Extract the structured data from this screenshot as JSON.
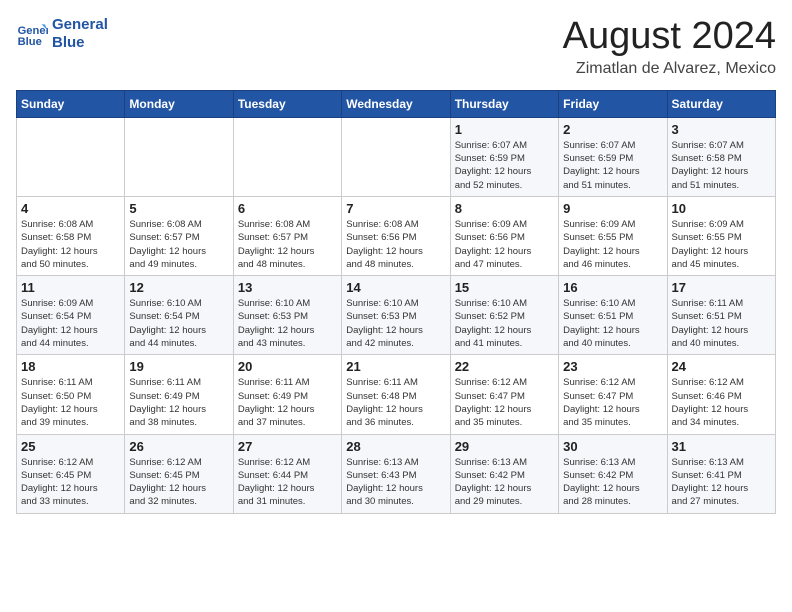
{
  "header": {
    "logo_line1": "General",
    "logo_line2": "Blue",
    "month_year": "August 2024",
    "location": "Zimatlan de Alvarez, Mexico"
  },
  "days_of_week": [
    "Sunday",
    "Monday",
    "Tuesday",
    "Wednesday",
    "Thursday",
    "Friday",
    "Saturday"
  ],
  "weeks": [
    [
      {
        "day": "",
        "info": ""
      },
      {
        "day": "",
        "info": ""
      },
      {
        "day": "",
        "info": ""
      },
      {
        "day": "",
        "info": ""
      },
      {
        "day": "1",
        "info": "Sunrise: 6:07 AM\nSunset: 6:59 PM\nDaylight: 12 hours\nand 52 minutes."
      },
      {
        "day": "2",
        "info": "Sunrise: 6:07 AM\nSunset: 6:59 PM\nDaylight: 12 hours\nand 51 minutes."
      },
      {
        "day": "3",
        "info": "Sunrise: 6:07 AM\nSunset: 6:58 PM\nDaylight: 12 hours\nand 51 minutes."
      }
    ],
    [
      {
        "day": "4",
        "info": "Sunrise: 6:08 AM\nSunset: 6:58 PM\nDaylight: 12 hours\nand 50 minutes."
      },
      {
        "day": "5",
        "info": "Sunrise: 6:08 AM\nSunset: 6:57 PM\nDaylight: 12 hours\nand 49 minutes."
      },
      {
        "day": "6",
        "info": "Sunrise: 6:08 AM\nSunset: 6:57 PM\nDaylight: 12 hours\nand 48 minutes."
      },
      {
        "day": "7",
        "info": "Sunrise: 6:08 AM\nSunset: 6:56 PM\nDaylight: 12 hours\nand 48 minutes."
      },
      {
        "day": "8",
        "info": "Sunrise: 6:09 AM\nSunset: 6:56 PM\nDaylight: 12 hours\nand 47 minutes."
      },
      {
        "day": "9",
        "info": "Sunrise: 6:09 AM\nSunset: 6:55 PM\nDaylight: 12 hours\nand 46 minutes."
      },
      {
        "day": "10",
        "info": "Sunrise: 6:09 AM\nSunset: 6:55 PM\nDaylight: 12 hours\nand 45 minutes."
      }
    ],
    [
      {
        "day": "11",
        "info": "Sunrise: 6:09 AM\nSunset: 6:54 PM\nDaylight: 12 hours\nand 44 minutes."
      },
      {
        "day": "12",
        "info": "Sunrise: 6:10 AM\nSunset: 6:54 PM\nDaylight: 12 hours\nand 44 minutes."
      },
      {
        "day": "13",
        "info": "Sunrise: 6:10 AM\nSunset: 6:53 PM\nDaylight: 12 hours\nand 43 minutes."
      },
      {
        "day": "14",
        "info": "Sunrise: 6:10 AM\nSunset: 6:53 PM\nDaylight: 12 hours\nand 42 minutes."
      },
      {
        "day": "15",
        "info": "Sunrise: 6:10 AM\nSunset: 6:52 PM\nDaylight: 12 hours\nand 41 minutes."
      },
      {
        "day": "16",
        "info": "Sunrise: 6:10 AM\nSunset: 6:51 PM\nDaylight: 12 hours\nand 40 minutes."
      },
      {
        "day": "17",
        "info": "Sunrise: 6:11 AM\nSunset: 6:51 PM\nDaylight: 12 hours\nand 40 minutes."
      }
    ],
    [
      {
        "day": "18",
        "info": "Sunrise: 6:11 AM\nSunset: 6:50 PM\nDaylight: 12 hours\nand 39 minutes."
      },
      {
        "day": "19",
        "info": "Sunrise: 6:11 AM\nSunset: 6:49 PM\nDaylight: 12 hours\nand 38 minutes."
      },
      {
        "day": "20",
        "info": "Sunrise: 6:11 AM\nSunset: 6:49 PM\nDaylight: 12 hours\nand 37 minutes."
      },
      {
        "day": "21",
        "info": "Sunrise: 6:11 AM\nSunset: 6:48 PM\nDaylight: 12 hours\nand 36 minutes."
      },
      {
        "day": "22",
        "info": "Sunrise: 6:12 AM\nSunset: 6:47 PM\nDaylight: 12 hours\nand 35 minutes."
      },
      {
        "day": "23",
        "info": "Sunrise: 6:12 AM\nSunset: 6:47 PM\nDaylight: 12 hours\nand 35 minutes."
      },
      {
        "day": "24",
        "info": "Sunrise: 6:12 AM\nSunset: 6:46 PM\nDaylight: 12 hours\nand 34 minutes."
      }
    ],
    [
      {
        "day": "25",
        "info": "Sunrise: 6:12 AM\nSunset: 6:45 PM\nDaylight: 12 hours\nand 33 minutes."
      },
      {
        "day": "26",
        "info": "Sunrise: 6:12 AM\nSunset: 6:45 PM\nDaylight: 12 hours\nand 32 minutes."
      },
      {
        "day": "27",
        "info": "Sunrise: 6:12 AM\nSunset: 6:44 PM\nDaylight: 12 hours\nand 31 minutes."
      },
      {
        "day": "28",
        "info": "Sunrise: 6:13 AM\nSunset: 6:43 PM\nDaylight: 12 hours\nand 30 minutes."
      },
      {
        "day": "29",
        "info": "Sunrise: 6:13 AM\nSunset: 6:42 PM\nDaylight: 12 hours\nand 29 minutes."
      },
      {
        "day": "30",
        "info": "Sunrise: 6:13 AM\nSunset: 6:42 PM\nDaylight: 12 hours\nand 28 minutes."
      },
      {
        "day": "31",
        "info": "Sunrise: 6:13 AM\nSunset: 6:41 PM\nDaylight: 12 hours\nand 27 minutes."
      }
    ]
  ]
}
